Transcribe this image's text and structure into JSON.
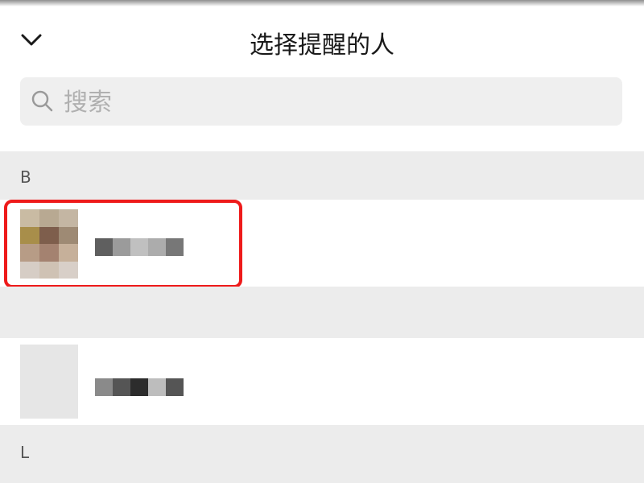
{
  "header": {
    "title": "选择提醒的人",
    "back_icon": "chevron-down-icon"
  },
  "search": {
    "placeholder": "搜索",
    "icon": "search-icon"
  },
  "sections": [
    {
      "letter": "B"
    },
    {
      "letter": ""
    },
    {
      "letter": "L"
    }
  ],
  "colors": {
    "highlight_border": "#ee1a1a",
    "section_bg": "#ececec",
    "search_bg": "#efefef"
  }
}
